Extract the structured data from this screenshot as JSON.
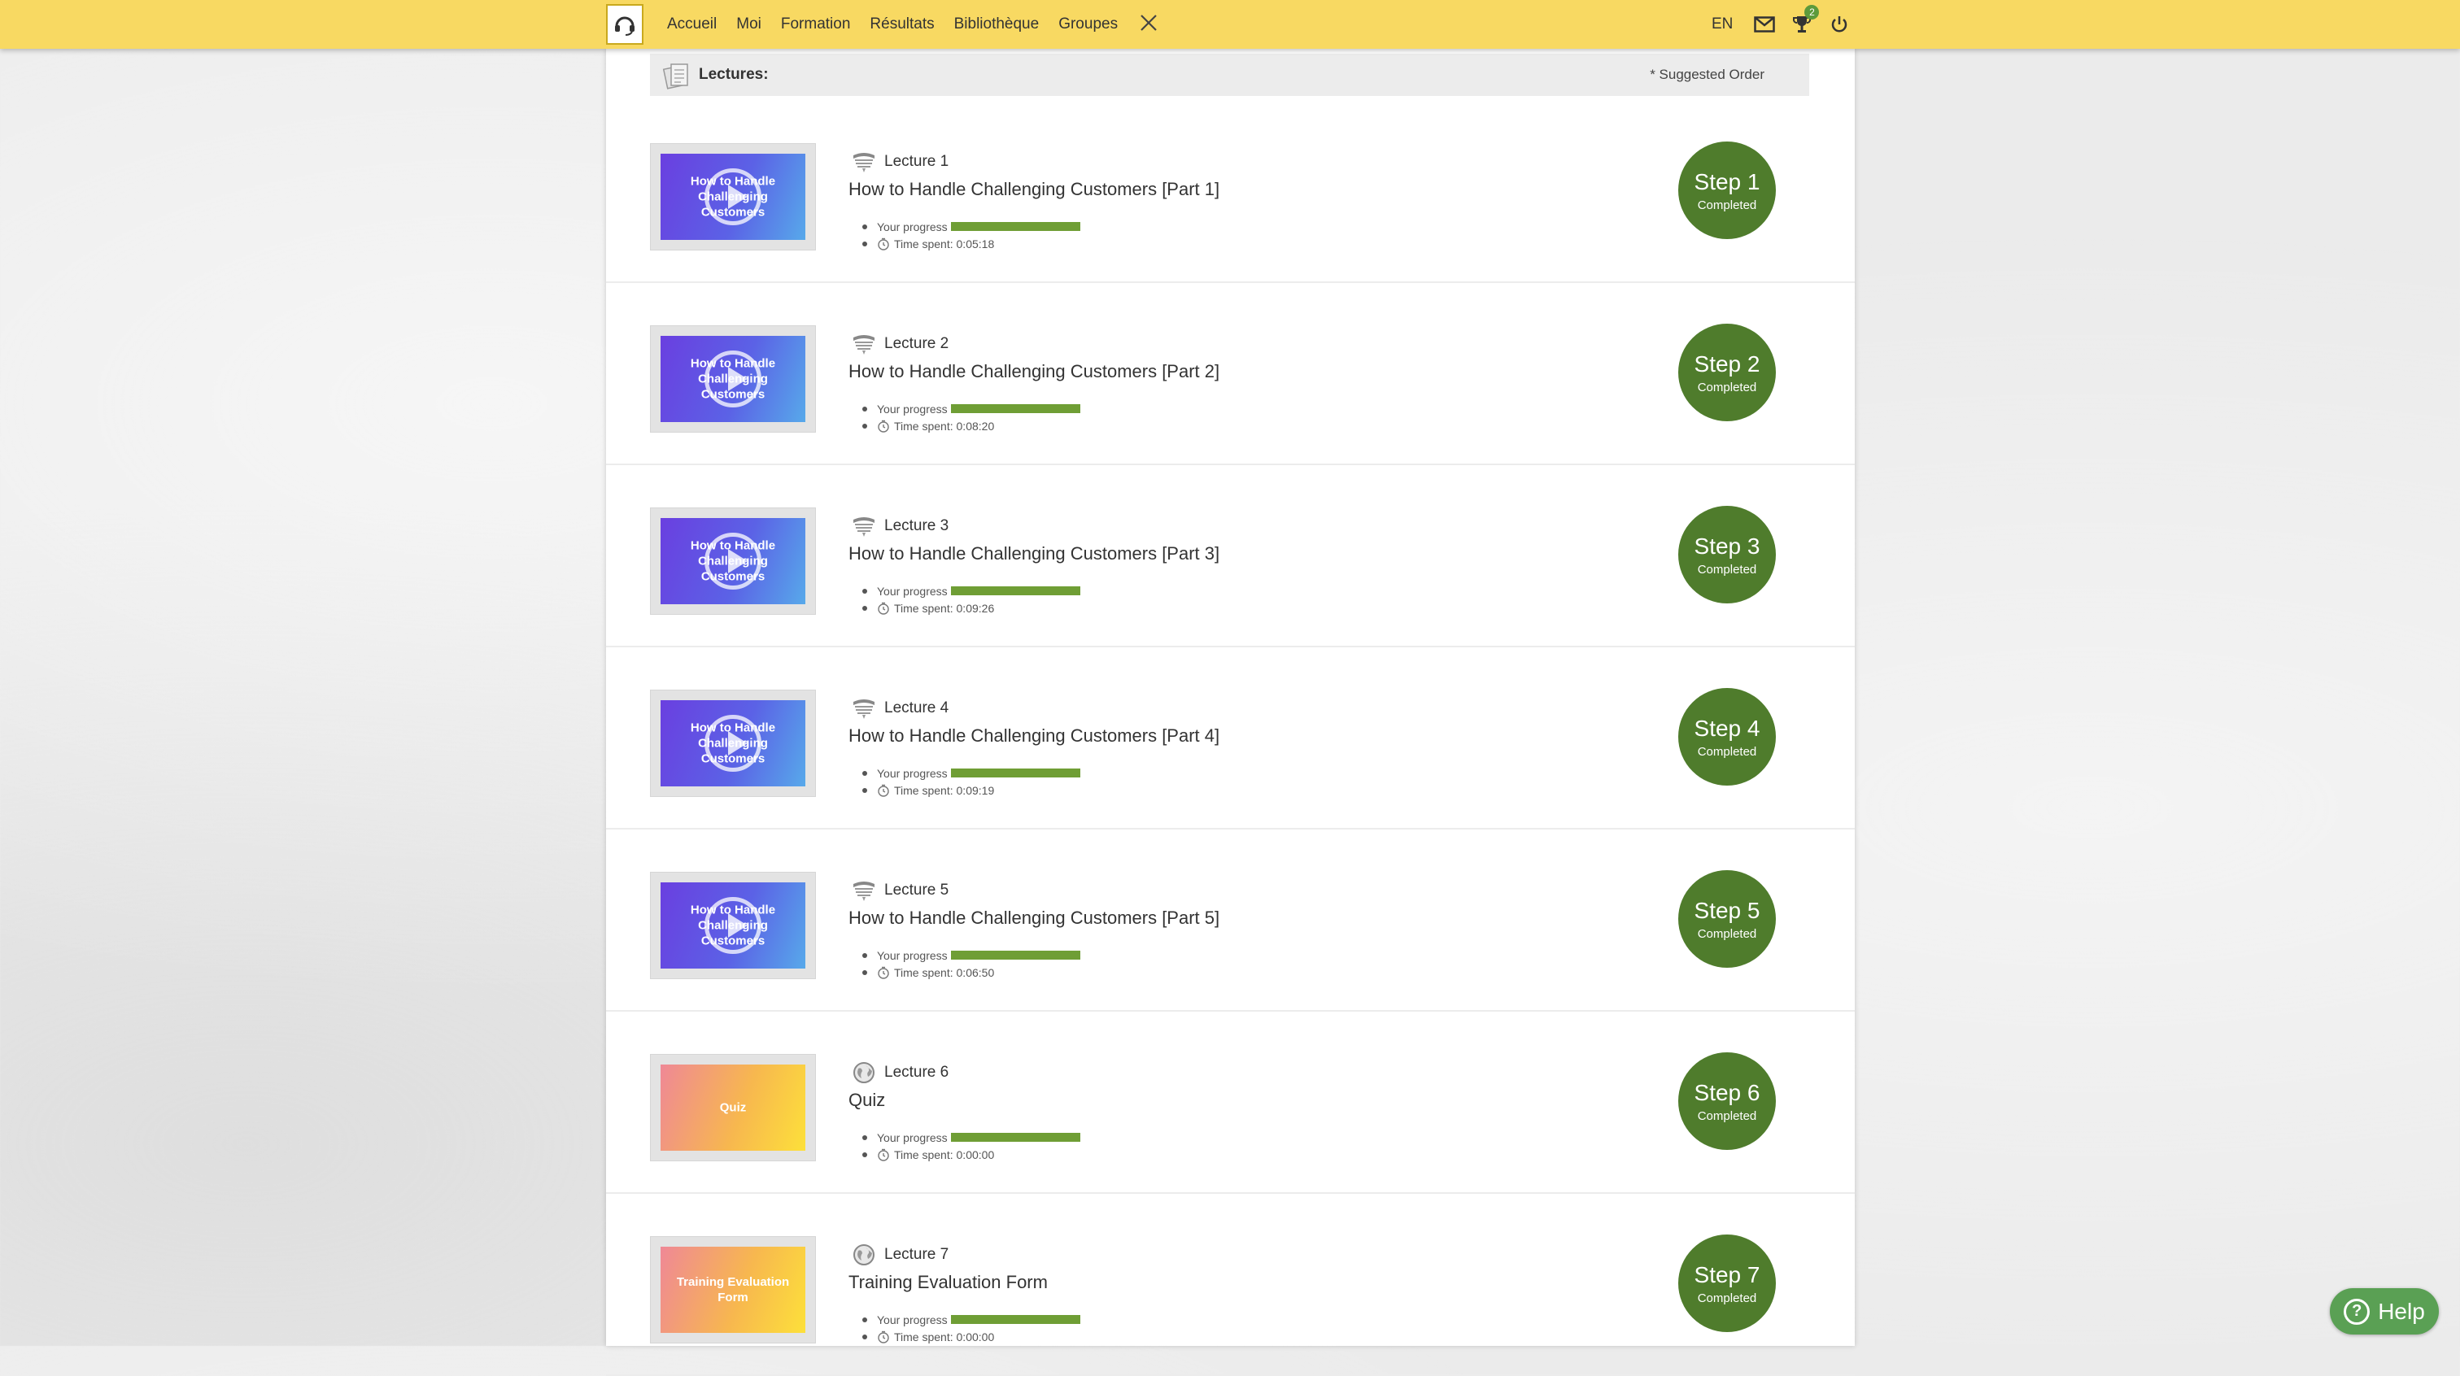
{
  "topbar": {
    "nav": [
      "Accueil",
      "Moi",
      "Formation",
      "Résultats",
      "Bibliothèque",
      "Groupes"
    ],
    "language": "EN",
    "notification_count": "2",
    "icons": [
      "headset-logo-icon",
      "close-x-icon",
      "mail-icon",
      "trophy-icon",
      "power-icon"
    ]
  },
  "lectures_header": {
    "title": "Lectures:",
    "suggested_order": "* Suggested Order"
  },
  "meta_labels": {
    "progress": "Your progress",
    "time_prefix": "Time spent: "
  },
  "lectures": [
    {
      "label": "Lecture 1",
      "title": "How to Handle Challenging Customers [Part 1]",
      "thumb_text": "How to Handle Challenging Customers",
      "thumb_type": "video",
      "progress": 1.0,
      "time_spent": "0:05:18",
      "step": "Step 1",
      "status": "Completed"
    },
    {
      "label": "Lecture 2",
      "title": "How to Handle Challenging Customers [Part 2]",
      "thumb_text": "How to Handle Challenging Customers",
      "thumb_type": "video",
      "progress": 1.0,
      "time_spent": "0:08:20",
      "step": "Step 2",
      "status": "Completed"
    },
    {
      "label": "Lecture 3",
      "title": "How to Handle Challenging Customers [Part 3]",
      "thumb_text": "How to Handle Challenging Customers",
      "thumb_type": "video",
      "progress": 1.0,
      "time_spent": "0:09:26",
      "step": "Step 3",
      "status": "Completed"
    },
    {
      "label": "Lecture 4",
      "title": "How to Handle Challenging Customers [Part 4]",
      "thumb_text": "How to Handle Challenging Customers",
      "thumb_type": "video",
      "progress": 1.0,
      "time_spent": "0:09:19",
      "step": "Step 4",
      "status": "Completed"
    },
    {
      "label": "Lecture 5",
      "title": "How to Handle Challenging Customers [Part 5]",
      "thumb_text": "How to Handle Challenging Customers",
      "thumb_type": "video",
      "progress": 1.0,
      "time_spent": "0:06:50",
      "step": "Step 5",
      "status": "Completed"
    },
    {
      "label": "Lecture 6",
      "title": "Quiz",
      "thumb_text": "Quiz",
      "thumb_type": "quiz",
      "progress": 1.0,
      "time_spent": "0:00:00",
      "step": "Step 6",
      "status": "Completed"
    },
    {
      "label": "Lecture 7",
      "title": "Training Evaluation Form",
      "thumb_text": "Training Evaluation Form",
      "thumb_type": "form",
      "progress": 1.0,
      "time_spent": "0:00:00",
      "step": "Step 7",
      "status": "Completed"
    }
  ],
  "help": {
    "label": "Help"
  },
  "colors": {
    "topbar": "#f8d962",
    "step_green": "#4f7c2c",
    "progress_green": "#6f9e35",
    "help_green": "#5aa054"
  }
}
